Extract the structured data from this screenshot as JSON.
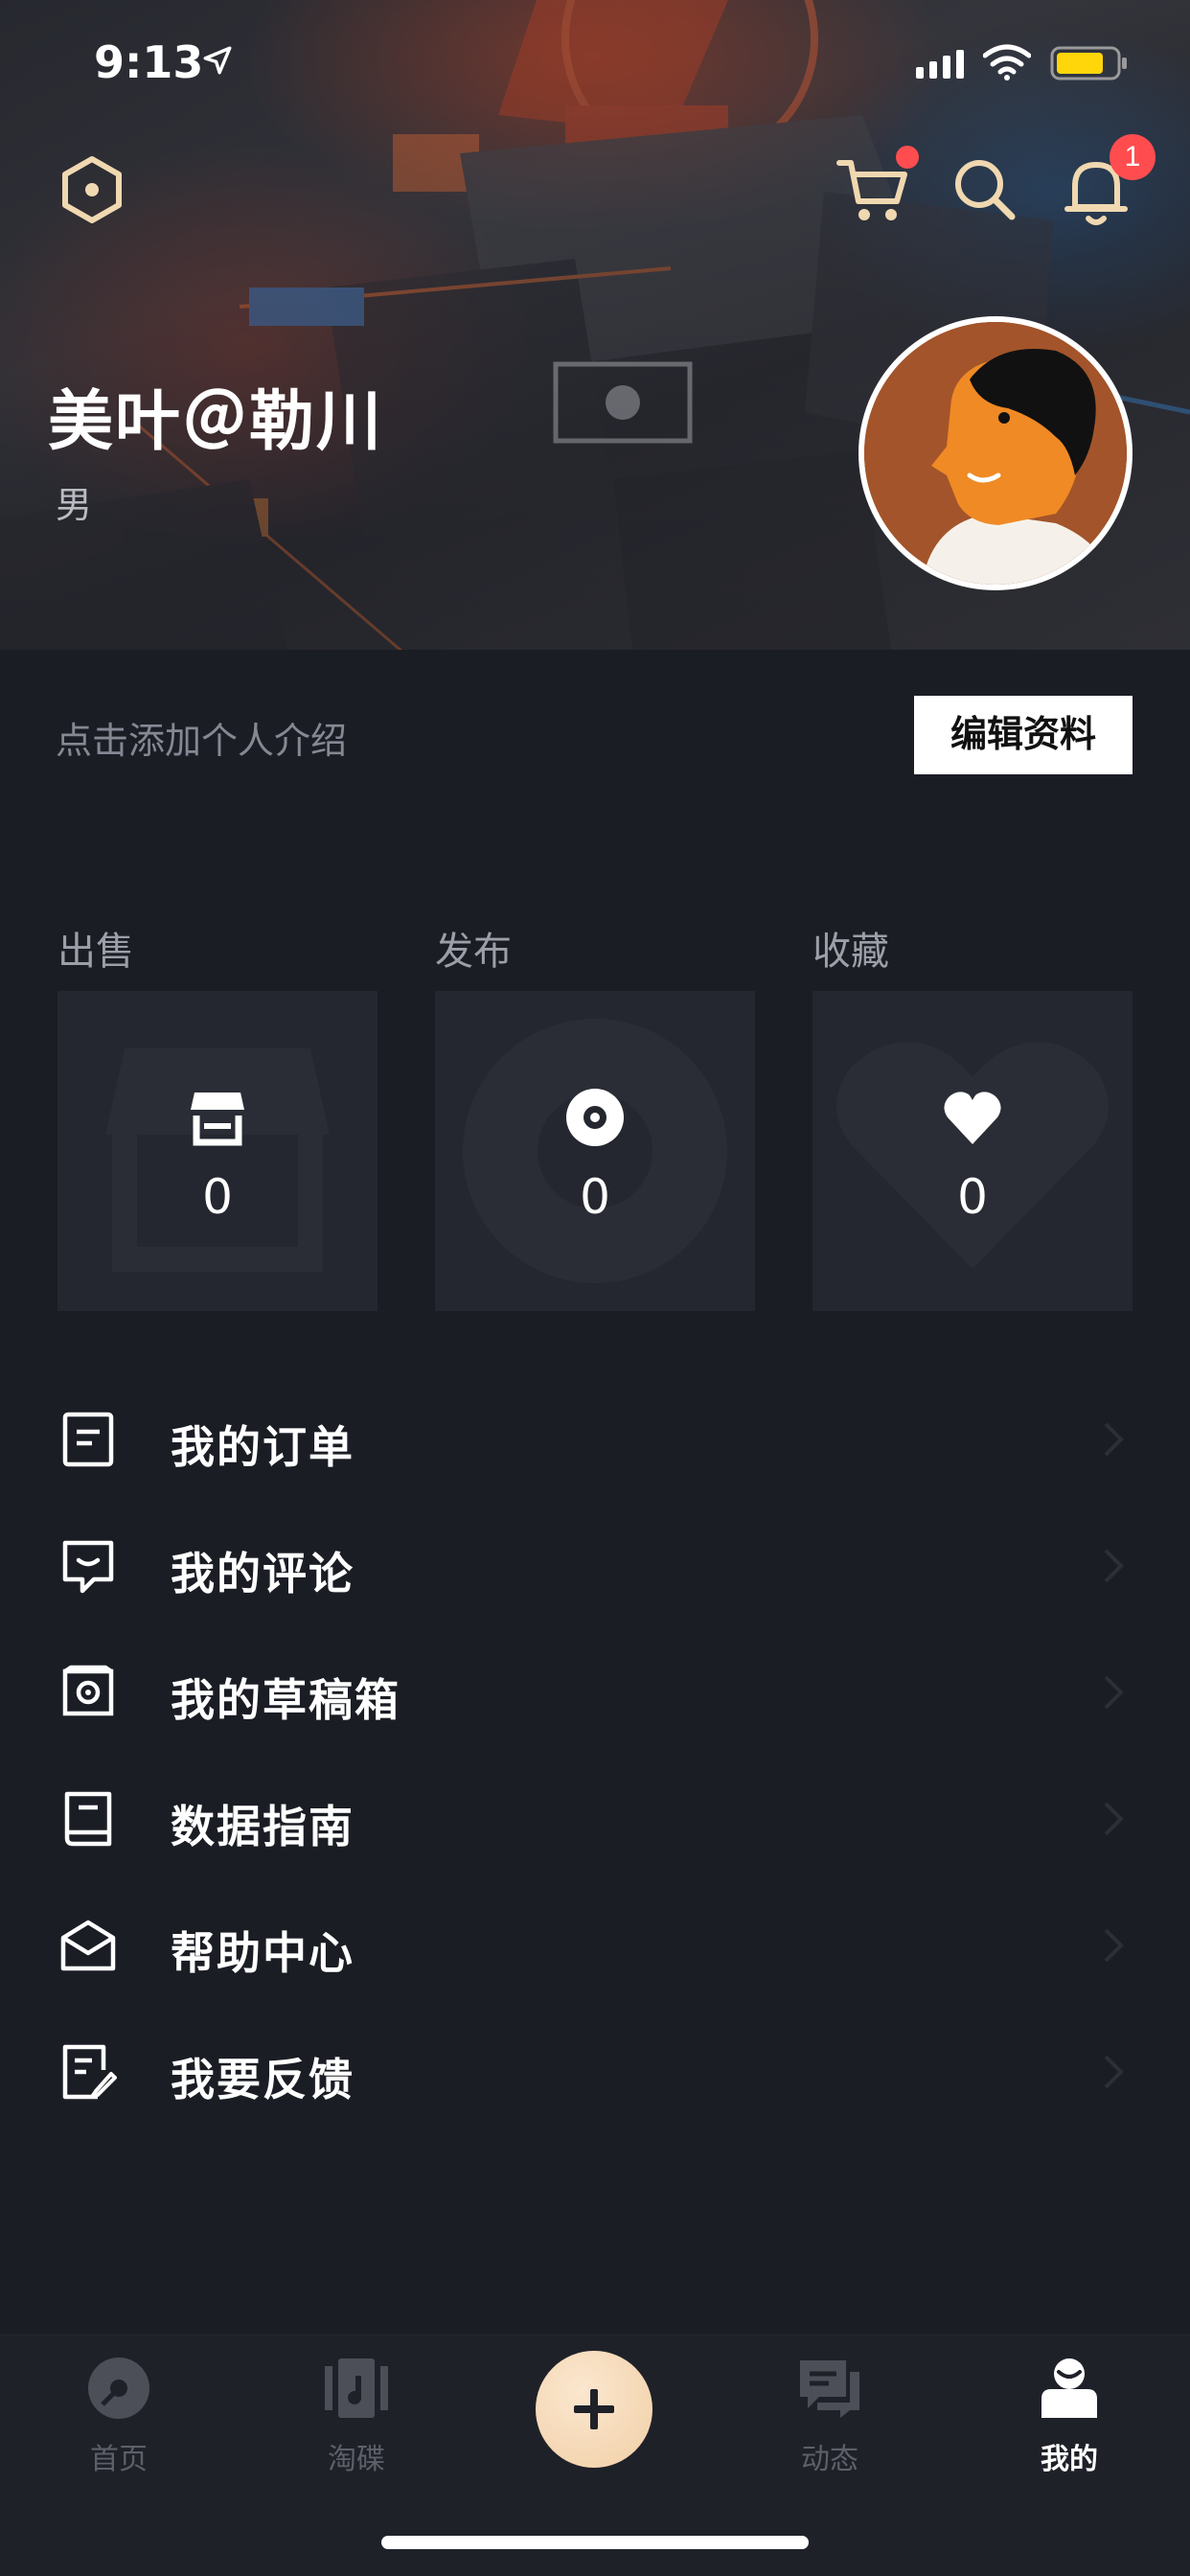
{
  "status_bar": {
    "time": "9:13"
  },
  "header": {
    "notification_count": "1",
    "user_name": "美叶＠勒川",
    "gender": "男"
  },
  "profile": {
    "intro_placeholder": "点击添加个人介绍",
    "edit_label": "编辑资料"
  },
  "stats": [
    {
      "label": "出售",
      "value": "0",
      "icon": "store-icon"
    },
    {
      "label": "发布",
      "value": "0",
      "icon": "disc-icon"
    },
    {
      "label": "收藏",
      "value": "0",
      "icon": "heart-icon"
    }
  ],
  "menu": [
    {
      "label": "我的订单",
      "icon": "order-icon"
    },
    {
      "label": "我的评论",
      "icon": "comment-icon"
    },
    {
      "label": "我的草稿箱",
      "icon": "draft-icon"
    },
    {
      "label": "数据指南",
      "icon": "book-icon"
    },
    {
      "label": "帮助中心",
      "icon": "mail-open-icon"
    },
    {
      "label": "我要反馈",
      "icon": "feedback-icon"
    }
  ],
  "tab_bar": [
    {
      "label": "首页",
      "icon": "vinyl-icon",
      "active": false
    },
    {
      "label": "淘碟",
      "icon": "music-album-icon",
      "active": false
    },
    {
      "label": "",
      "icon": "plus-icon",
      "active": false
    },
    {
      "label": "动态",
      "icon": "chat-icon",
      "active": false
    },
    {
      "label": "我的",
      "icon": "user-icon",
      "active": true
    }
  ],
  "colors": {
    "background": "#1b1d25",
    "card": "#24272f",
    "accent_icon": "#f0d8b0",
    "badge": "#ff4d4f",
    "fab": "#f1cfa6"
  }
}
